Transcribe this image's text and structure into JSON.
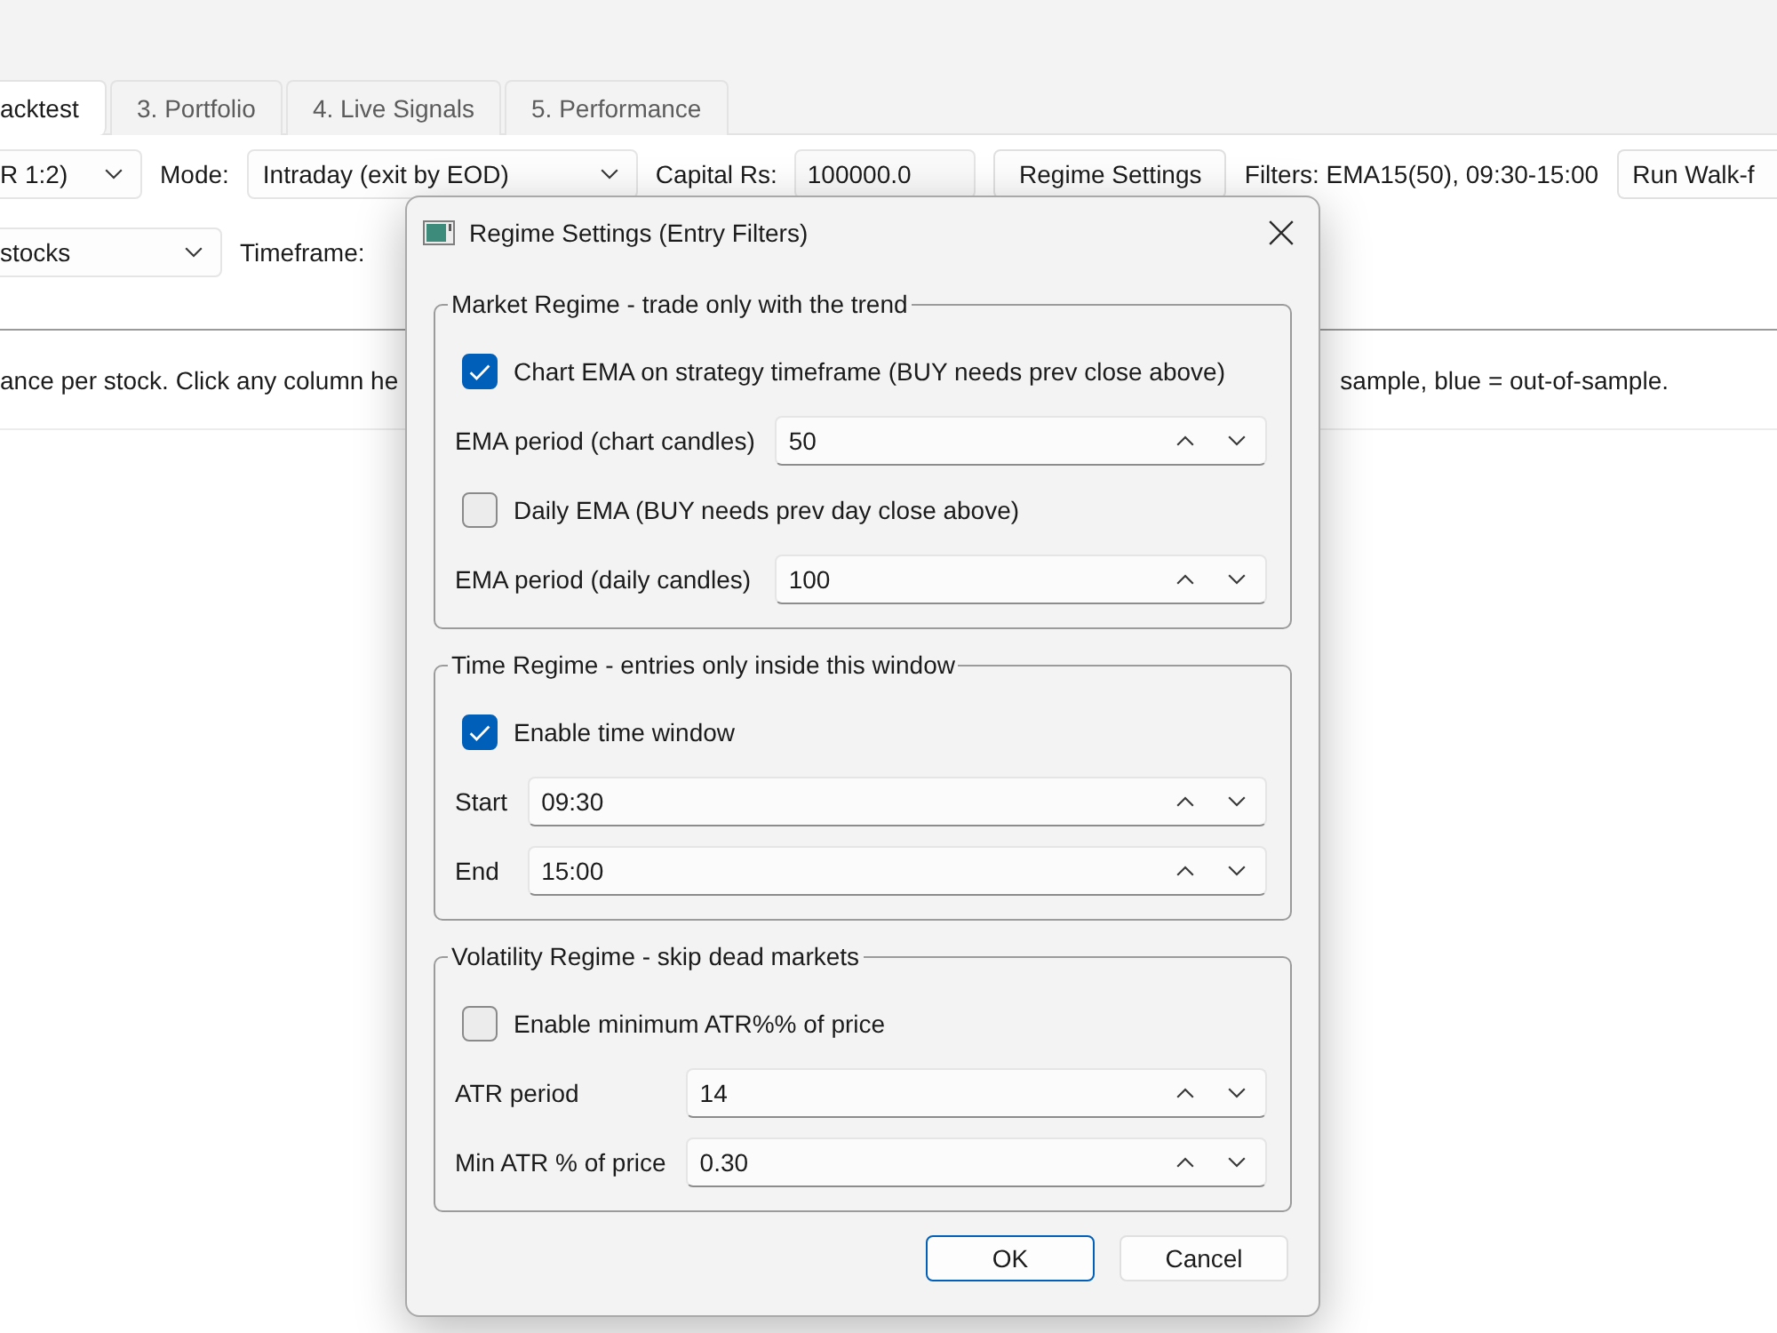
{
  "tabs": [
    {
      "label": "acktest",
      "selected": true
    },
    {
      "label": "3. Portfolio",
      "selected": false
    },
    {
      "label": "4. Live Signals",
      "selected": false
    },
    {
      "label": "5. Performance",
      "selected": false
    }
  ],
  "toolbar_1": [
    {
      "kind": "dropdown",
      "value": "R 1:2)"
    },
    {
      "kind": "label",
      "text": "Mode:"
    },
    {
      "kind": "dropdown",
      "value": "Intraday (exit by EOD)"
    },
    {
      "kind": "label",
      "text": "Capital Rs:"
    },
    {
      "kind": "field",
      "value": "100000.0"
    },
    {
      "kind": "button",
      "text": "Regime Settings"
    },
    {
      "kind": "label",
      "text": "Filters: EMA15(50), 09:30-15:00"
    },
    {
      "kind": "button",
      "text": "Run Walk-f"
    }
  ],
  "toolbar_2": [
    {
      "kind": "dropdown",
      "value": "stocks"
    },
    {
      "kind": "label",
      "text": "Timeframe:"
    }
  ],
  "info_text": [
    "ance per stock. Click any column he",
    "sample, blue = out-of-sample."
  ],
  "dialog": {
    "title": "Regime Settings (Entry Filters)",
    "groups": [
      {
        "title": "Market Regime - trade only with the trend",
        "rows": [
          {
            "kind": "checkbox",
            "label": "Chart EMA on strategy timeframe (BUY needs prev close above)",
            "checked": true
          },
          {
            "kind": "spinbox",
            "label": "EMA period (chart candles)",
            "value": "50"
          },
          {
            "kind": "checkbox",
            "label": "Daily EMA (BUY needs prev day close above)",
            "checked": false
          },
          {
            "kind": "spinbox",
            "label": "EMA period (daily candles)",
            "value": "100"
          }
        ]
      },
      {
        "title": "Time Regime - entries only inside this window",
        "rows": [
          {
            "kind": "checkbox",
            "label": "Enable time window",
            "checked": true
          },
          {
            "kind": "spinbox",
            "label": "Start",
            "value": "09:30"
          },
          {
            "kind": "spinbox",
            "label": "End",
            "value": "15:00"
          }
        ]
      },
      {
        "title": "Volatility Regime - skip dead markets",
        "rows": [
          {
            "kind": "checkbox",
            "label": "Enable minimum ATR%% of price",
            "checked": false
          },
          {
            "kind": "spinbox",
            "label": "ATR period",
            "value": "14"
          },
          {
            "kind": "spinbox",
            "label": "Min ATR % of price",
            "value": "0.30"
          }
        ]
      }
    ],
    "buttons": [
      {
        "label": "OK",
        "default": true
      },
      {
        "label": "Cancel",
        "default": false
      }
    ]
  }
}
